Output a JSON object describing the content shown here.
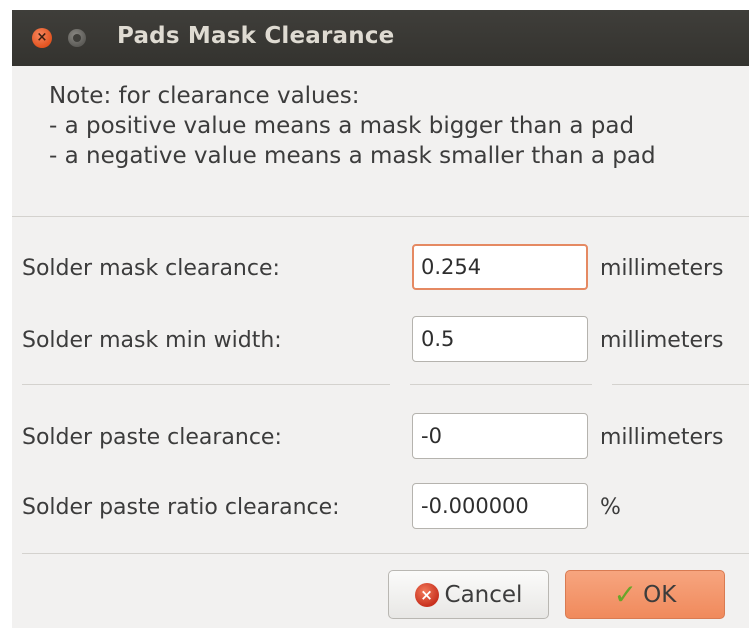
{
  "window": {
    "title": "Pads Mask Clearance",
    "close_glyph": "×"
  },
  "note": {
    "line1": "Note: for clearance values:",
    "line2": "- a positive value means a mask bigger than a pad",
    "line3": "- a negative value means a mask smaller than a pad"
  },
  "fields": {
    "mask_clearance": {
      "label": "Solder mask clearance:",
      "value": "0.254",
      "unit": "millimeters"
    },
    "mask_min_width": {
      "label": "Solder mask min width:",
      "value": "0.5",
      "unit": "millimeters"
    },
    "paste_clearance": {
      "label": "Solder paste clearance:",
      "value": "-0",
      "unit": "millimeters"
    },
    "paste_ratio": {
      "label": "Solder paste ratio clearance:",
      "value": "-0.000000",
      "unit": "%"
    }
  },
  "buttons": {
    "cancel": {
      "label": "Cancel",
      "icon": "cancel-icon",
      "glyph": "×"
    },
    "ok": {
      "label": "OK",
      "icon": "checkmark-icon",
      "glyph": "✓"
    }
  },
  "colors": {
    "titlebar": "#3c3b37",
    "focus_border": "#e58962",
    "ok_button": "#f08a5c"
  }
}
